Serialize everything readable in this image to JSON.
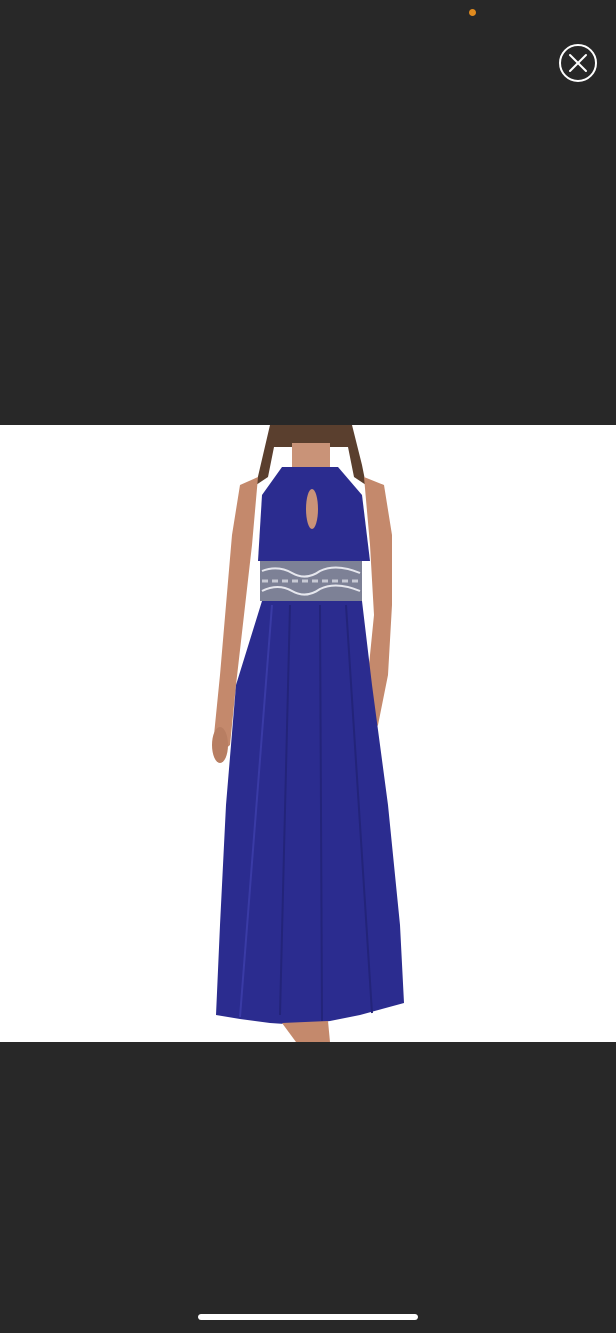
{
  "viewer": {
    "mode": "fullscreen-image",
    "background_color": "#282828"
  },
  "status_indicator": {
    "color": "#e08a1e"
  },
  "close_button": {
    "icon": "close-icon",
    "color": "#ffffff"
  },
  "photo": {
    "subject": "product-photo",
    "background_color": "#ffffff",
    "dress_color": "#2b2c8f",
    "waistband_color": "#7d8196"
  },
  "home_indicator": {
    "color": "#ffffff"
  }
}
